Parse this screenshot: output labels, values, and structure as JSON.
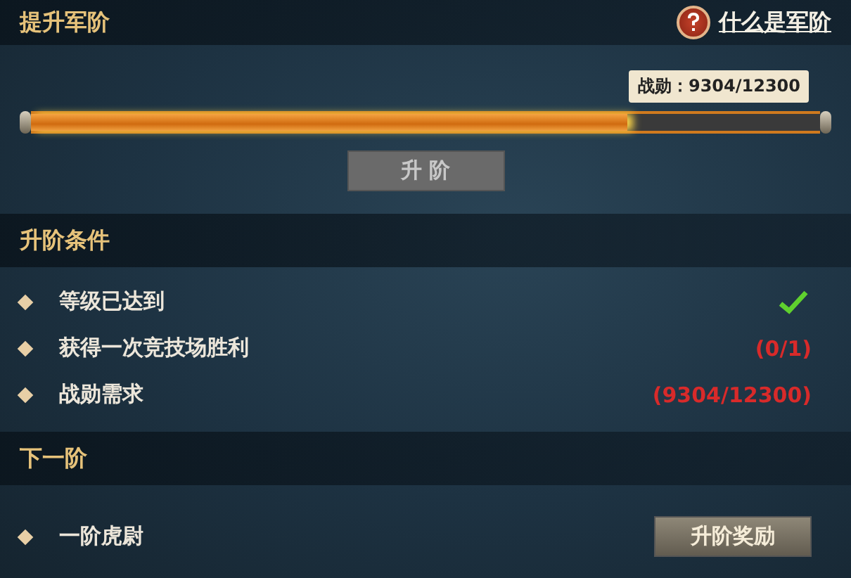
{
  "header": {
    "title": "提升军阶",
    "help_link": "什么是军阶"
  },
  "progress": {
    "reading": "战勋：9304/12300",
    "level": 0.756
  },
  "upgrade_button": {
    "label": "升 阶",
    "disabled": true
  },
  "conditions_section": {
    "title": "升阶条件",
    "items": [
      {
        "label": "等级已达到",
        "met": true
      },
      {
        "label": "获得一次竞技场胜利",
        "met": false,
        "status": "(0/1)"
      },
      {
        "label": "战勋需求",
        "met": false,
        "status": "(9304/12300)"
      }
    ]
  },
  "next_section": {
    "title": "下一阶",
    "items": [
      {
        "label": "一阶虎尉",
        "button": "升阶奖励"
      }
    ]
  }
}
